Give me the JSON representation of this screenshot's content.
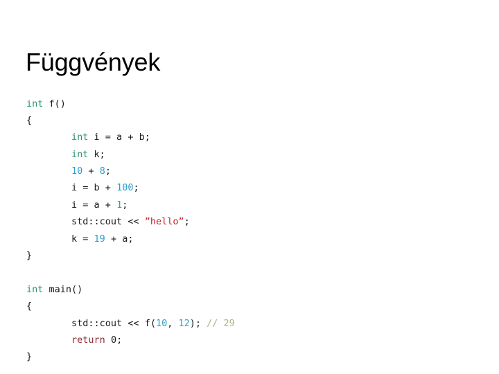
{
  "slide": {
    "title": "Függvények",
    "background_color": "#ffffff",
    "title_color": "#000000"
  },
  "syntax_colors": {
    "keyword": "#2e9470",
    "return_keyword": "#8e2a38",
    "number": "#2b9fc9",
    "string": "#c3202b",
    "comment": "#adb482",
    "plain": "#1a1a1a"
  },
  "code": {
    "language": "cpp",
    "full_text": "int f()\n{\n        int i = a + b;\n        int k;\n        10 + 8;\n        i = b + 100;\n        i = a + 1;\n        std::cout << ”hello”;\n        k = 19 + a;\n}\n\nint main()\n{\n        std::cout << f(10, 12); // 29\n        return 0;\n}",
    "lines": [
      {
        "indent": "",
        "tokens": [
          {
            "t": "int",
            "k": "kw"
          },
          {
            "t": " f()",
            "k": "plain"
          }
        ]
      },
      {
        "indent": "",
        "tokens": [
          {
            "t": "{",
            "k": "plain"
          }
        ]
      },
      {
        "indent": "        ",
        "tokens": [
          {
            "t": "int",
            "k": "kw"
          },
          {
            "t": " i = a + b;",
            "k": "plain"
          }
        ]
      },
      {
        "indent": "        ",
        "tokens": [
          {
            "t": "int",
            "k": "kw"
          },
          {
            "t": " k;",
            "k": "plain"
          }
        ]
      },
      {
        "indent": "        ",
        "tokens": [
          {
            "t": "10",
            "k": "num"
          },
          {
            "t": " + ",
            "k": "plain"
          },
          {
            "t": "8",
            "k": "num"
          },
          {
            "t": ";",
            "k": "plain"
          }
        ]
      },
      {
        "indent": "        ",
        "tokens": [
          {
            "t": "i = b + ",
            "k": "plain"
          },
          {
            "t": "100",
            "k": "num"
          },
          {
            "t": ";",
            "k": "plain"
          }
        ]
      },
      {
        "indent": "        ",
        "tokens": [
          {
            "t": "i = a + ",
            "k": "plain"
          },
          {
            "t": "1",
            "k": "num"
          },
          {
            "t": ";",
            "k": "plain"
          }
        ]
      },
      {
        "indent": "        ",
        "tokens": [
          {
            "t": "std::cout << ",
            "k": "plain"
          },
          {
            "t": "”hello”",
            "k": "str"
          },
          {
            "t": ";",
            "k": "plain"
          }
        ]
      },
      {
        "indent": "        ",
        "tokens": [
          {
            "t": "k = ",
            "k": "plain"
          },
          {
            "t": "19",
            "k": "num"
          },
          {
            "t": " + a;",
            "k": "plain"
          }
        ]
      },
      {
        "indent": "",
        "tokens": [
          {
            "t": "}",
            "k": "plain"
          }
        ]
      },
      {
        "indent": "",
        "tokens": []
      },
      {
        "indent": "",
        "tokens": [
          {
            "t": "int",
            "k": "kw"
          },
          {
            "t": " main()",
            "k": "plain"
          }
        ]
      },
      {
        "indent": "",
        "tokens": [
          {
            "t": "{",
            "k": "plain"
          }
        ]
      },
      {
        "indent": "        ",
        "tokens": [
          {
            "t": "std::cout << f(",
            "k": "plain"
          },
          {
            "t": "10",
            "k": "num"
          },
          {
            "t": ", ",
            "k": "plain"
          },
          {
            "t": "12",
            "k": "num"
          },
          {
            "t": "); ",
            "k": "plain"
          },
          {
            "t": "// 29",
            "k": "cmt"
          }
        ]
      },
      {
        "indent": "        ",
        "tokens": [
          {
            "t": "return",
            "k": "ret"
          },
          {
            "t": " ",
            "k": "plain"
          },
          {
            "t": "0",
            "k": "plain"
          },
          {
            "t": ";",
            "k": "plain"
          }
        ]
      },
      {
        "indent": "",
        "tokens": [
          {
            "t": "}",
            "k": "plain"
          }
        ]
      }
    ]
  }
}
